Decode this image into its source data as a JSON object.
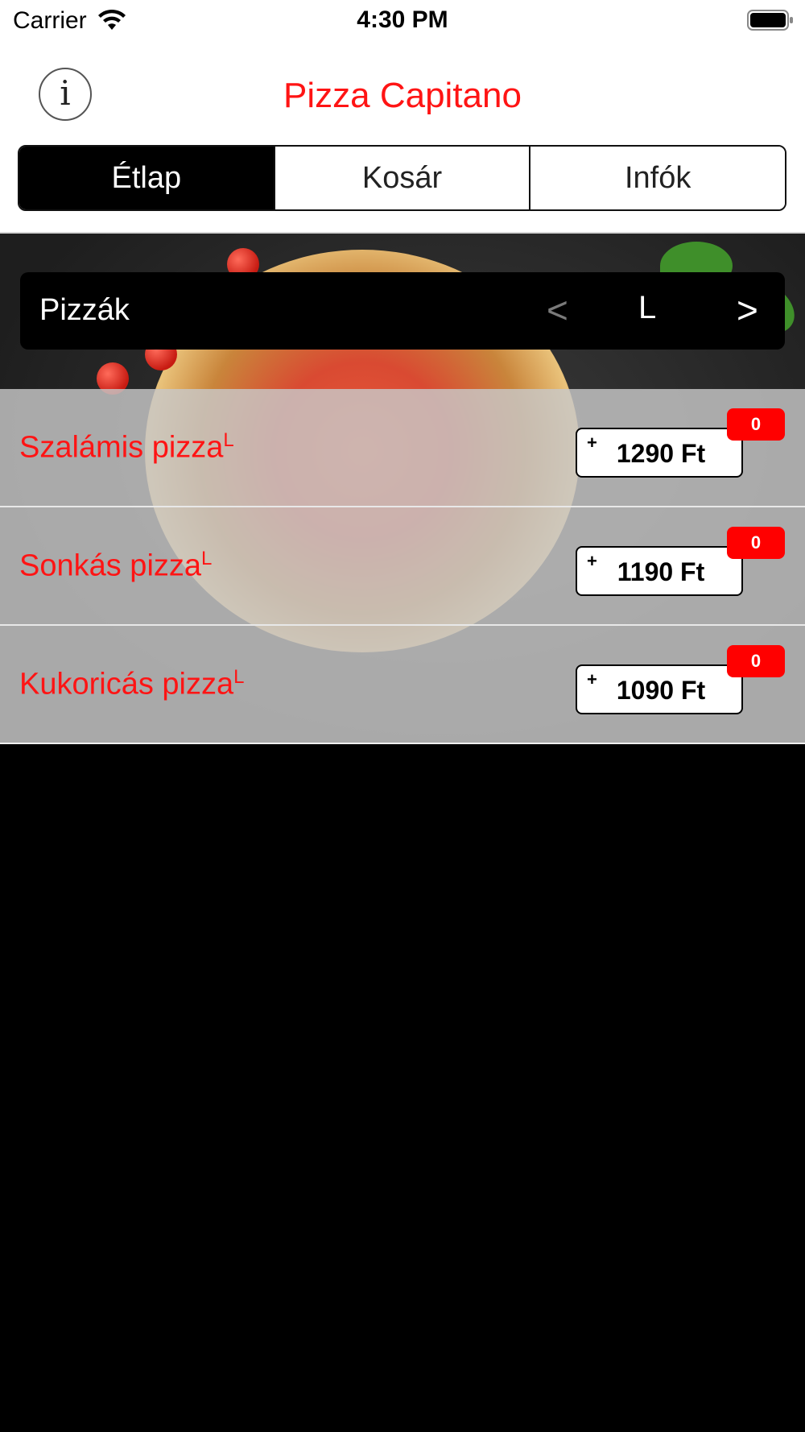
{
  "status_bar": {
    "carrier": "Carrier",
    "time": "4:30 PM",
    "wifi_icon": "wifi-icon",
    "battery_icon": "battery-full-icon"
  },
  "header": {
    "info_icon_glyph": "i",
    "title": "Pizza Capitano",
    "title_color": "#ff1414",
    "tabs": [
      {
        "label": "Étlap",
        "active": true
      },
      {
        "label": "Kosár",
        "active": false
      },
      {
        "label": "Infók",
        "active": false
      }
    ]
  },
  "category": {
    "name": "Pizzák",
    "prev": "<",
    "size": "L",
    "next": ">"
  },
  "items": [
    {
      "name": "Szalámis pizza",
      "tag": "L",
      "plus": "+",
      "price": "1290 Ft",
      "count": "0"
    },
    {
      "name": "Sonkás pizza",
      "tag": "L",
      "plus": "+",
      "price": "1190 Ft",
      "count": "0"
    },
    {
      "name": "Kukoricás pizza",
      "tag": "L",
      "plus": "+",
      "price": "1090 Ft",
      "count": "0"
    }
  ],
  "colors": {
    "accent_red": "#ff1414",
    "badge_red": "#ff0000",
    "background": "#000000"
  }
}
